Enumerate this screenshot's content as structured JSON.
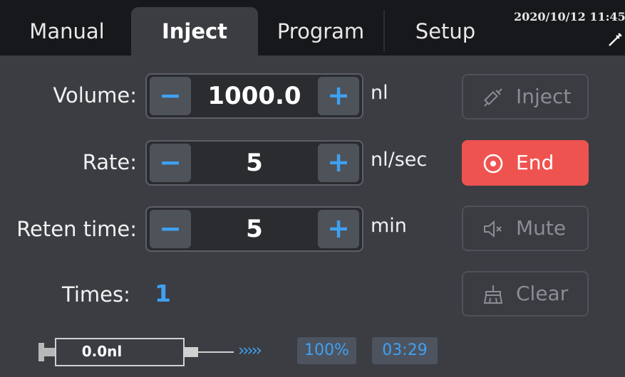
{
  "tabs": [
    {
      "label": "Manual",
      "active": false
    },
    {
      "label": "Inject",
      "active": true
    },
    {
      "label": "Program",
      "active": false
    },
    {
      "label": "Setup",
      "active": false
    }
  ],
  "header": {
    "datetime": "2020/10/12 11:45",
    "icon": "syringe-tool-icon"
  },
  "volume": {
    "label": "Volume:",
    "value": "1000.0",
    "unit": "nl"
  },
  "rate": {
    "label": "Rate:",
    "value": "5",
    "unit": "nl/sec"
  },
  "reten": {
    "label": "Reten time:",
    "value": "5",
    "unit": "min"
  },
  "stepper": {
    "minus": "−",
    "plus": "+"
  },
  "times": {
    "label": "Times:",
    "value": "1"
  },
  "buttons": {
    "inject": "Inject",
    "end": "End",
    "mute": "Mute",
    "clear": "Clear"
  },
  "status": {
    "syringe_volume": "0.0nl",
    "arrows": "›››››",
    "percent": "100%",
    "time": "03:29"
  },
  "colors": {
    "accent": "#3ea1f2",
    "danger": "#ef5350",
    "background": "#3b3d42",
    "tabbar": "#17181b"
  }
}
